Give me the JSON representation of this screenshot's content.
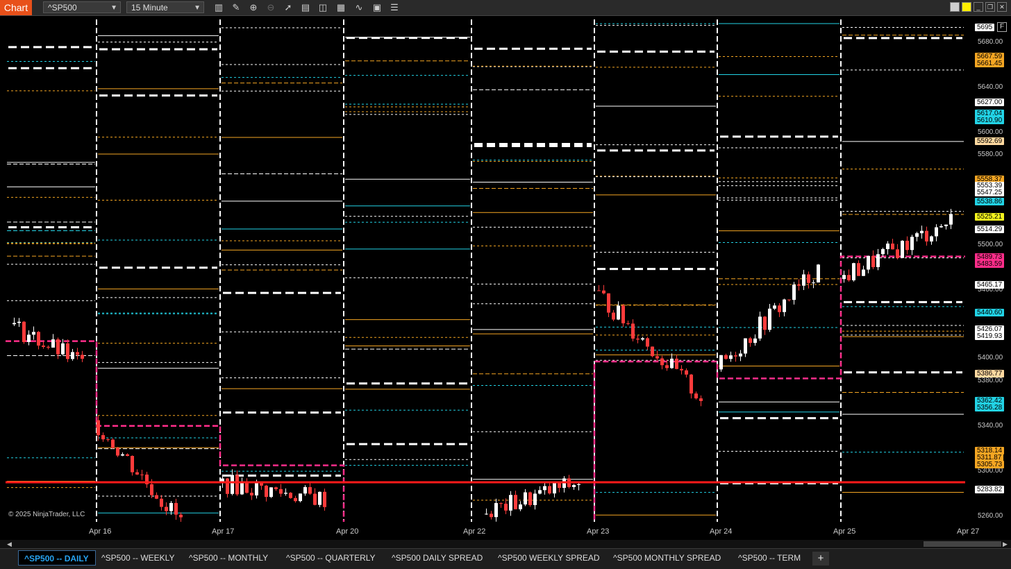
{
  "toolbar": {
    "badge": "Chart",
    "instrument": "^SP500",
    "interval": "15 Minute",
    "icons": [
      "bar-type-icon",
      "pencil-icon",
      "zoom-in-icon",
      "zoom-out-icon",
      "pointer-icon",
      "data-box-icon",
      "panels-icon",
      "templates-icon",
      "indicators-icon",
      "strategies-icon",
      "properties-icon"
    ]
  },
  "window_buttons": {
    "minimize": "_",
    "restore": "❐",
    "close": "✕"
  },
  "price_axis": {
    "ticks": [
      "5680.00",
      "5640.00",
      "5600.00",
      "5580.00",
      "5500.00",
      "5460.00",
      "5400.00",
      "5380.00",
      "5340.00",
      "5300.00",
      "5260.00"
    ],
    "f_label": "F",
    "tags": [
      {
        "text": "5695",
        "color": "#ffffff"
      },
      {
        "text": "5667.59",
        "color": "#f5a623"
      },
      {
        "text": "5661.45",
        "color": "#f5a623"
      },
      {
        "text": "5627.00",
        "color": "#ffffff"
      },
      {
        "text": "5617.04",
        "color": "#22d3e6"
      },
      {
        "text": "5610.90",
        "color": "#22d3e6"
      },
      {
        "text": "5592.69",
        "color": "#ffd9a0"
      },
      {
        "text": "5558.37",
        "color": "#f5a623"
      },
      {
        "text": "5553.39",
        "color": "#ffffff"
      },
      {
        "text": "5547.25",
        "color": "#ffffff"
      },
      {
        "text": "5538.86",
        "color": "#22d3e6"
      },
      {
        "text": "5525.21",
        "color": "#f5f51e"
      },
      {
        "text": "5514.29",
        "color": "#ffffff"
      },
      {
        "text": "5489.73",
        "color": "#ff2d8a"
      },
      {
        "text": "5483.59",
        "color": "#ff2d8a"
      },
      {
        "text": "5465.17",
        "color": "#ffffff"
      },
      {
        "text": "5440.60",
        "color": "#22d3e6"
      },
      {
        "text": "5426.07",
        "color": "#ffffff"
      },
      {
        "text": "5419.93",
        "color": "#ffffff"
      },
      {
        "text": "5386.77",
        "color": "#ffd9a0"
      },
      {
        "text": "5362.42",
        "color": "#22d3e6"
      },
      {
        "text": "5356.28",
        "color": "#22d3e6"
      },
      {
        "text": "5318.14",
        "color": "#f5a623"
      },
      {
        "text": "5311.87",
        "color": "#f5a623"
      },
      {
        "text": "5305.73",
        "color": "#f5a623"
      },
      {
        "text": "5283.82",
        "color": "#ffffff"
      }
    ]
  },
  "time_axis": {
    "labels": [
      "Apr 16",
      "Apr 17",
      "Apr 20",
      "Apr 22",
      "Apr 23",
      "Apr 24",
      "Apr 25",
      "Apr 27"
    ]
  },
  "copyright": "© 2025 NinjaTrader, LLC",
  "tabs": [
    {
      "label": "^SP500 -- DAILY",
      "active": true
    },
    {
      "label": "^SP500 -- WEEKLY",
      "active": false
    },
    {
      "label": "^SP500 -- MONTHLY",
      "active": false
    },
    {
      "label": "^SP500 -- QUARTERLY",
      "active": false
    },
    {
      "label": "^SP500 DAILY SPREAD",
      "active": false
    },
    {
      "label": "^SP500 WEEKLY SPREAD",
      "active": false
    },
    {
      "label": "^SP500 MONTHLY SPREAD",
      "active": false
    },
    {
      "label": "^SP500 -- TERM",
      "active": false
    }
  ],
  "add_tab": "+",
  "colors": {
    "accent": "#e8501a",
    "level_white": "#ffffff",
    "level_orange": "#f5a623",
    "level_cyan": "#22d3e6",
    "level_magenta": "#ff2d8a",
    "key_level_red": "#ff1a1a",
    "candle_up": "#ffffff",
    "candle_down": "#ff3b3b",
    "tab_active": "#27a4f2"
  },
  "chart_data": {
    "type": "candlestick",
    "instrument": "^SP500",
    "interval": "15 Minute",
    "x_labels": [
      "Apr 16",
      "Apr 17",
      "Apr 20",
      "Apr 22",
      "Apr 23",
      "Apr 24",
      "Apr 25",
      "Apr 27"
    ],
    "y_range": [
      5255,
      5700
    ],
    "key_level": 5290,
    "sessions": [
      {
        "label": "Apr 16 pre",
        "open": 5430,
        "close": 5395,
        "low": 5385,
        "high": 5438
      },
      {
        "label": "Apr 16",
        "open": 5345,
        "close": 5255,
        "low": 5255,
        "high": 5368
      },
      {
        "label": "Apr 17",
        "open": 5290,
        "close": 5275,
        "low": 5258,
        "high": 5318
      },
      {
        "label": "Apr 22",
        "open": 5262,
        "close": 5290,
        "low": 5255,
        "high": 5305
      },
      {
        "label": "Apr 23",
        "open": 5460,
        "close": 5365,
        "low": 5355,
        "high": 5465
      },
      {
        "label": "Apr 24",
        "open": 5390,
        "close": 5480,
        "low": 5382,
        "high": 5488
      },
      {
        "label": "Apr 25",
        "open": 5470,
        "close": 5522,
        "low": 5455,
        "high": 5528
      }
    ],
    "levels": [
      5695,
      5667.59,
      5661.45,
      5627.0,
      5617.04,
      5610.9,
      5592.69,
      5558.37,
      5553.39,
      5547.25,
      5538.86,
      5525.21,
      5514.29,
      5489.73,
      5483.59,
      5465.17,
      5440.6,
      5426.07,
      5419.93,
      5386.77,
      5362.42,
      5356.28,
      5318.14,
      5311.87,
      5305.73,
      5283.82
    ]
  }
}
